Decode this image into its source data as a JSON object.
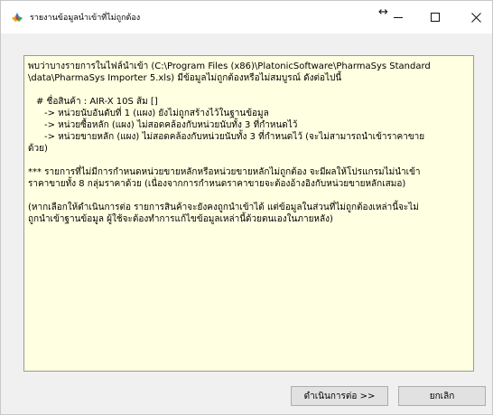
{
  "window": {
    "title": "รายงานข้อมูลนำเข้าที่ไม่ถูกต้อง",
    "app_icon": "pharmacy-app-icon",
    "controls": {
      "resize": "↔",
      "minimize": "minimize-icon",
      "maximize": "maximize-icon",
      "close": "×"
    }
  },
  "message": {
    "line1": "พบว่าบางรายการในไฟล์นำเข้า (C:\\Program Files (x86)\\PlatonicSoftware\\PharmaSys Standard",
    "line2": "\\data\\PharmaSys Importer 5.xls) มีข้อมูลไม่ถูกต้องหรือไม่สมบูรณ์ ดังต่อไปนี้",
    "product": "# ชื่อสินค้า : AIR-X 10S ส้ม []",
    "issue1": "-> หน่วยนับอันดับที่ 1 (แผง) ยังไม่ถูกสร้างไว้ในฐานข้อมูล",
    "issue2": "-> หน่วยซื้อหลัก (แผง) ไม่สอดคล้องกับหน่วยนับทั้ง 3 ที่กำหนดไว้",
    "issue3a": "-> หน่วยขายหลัก (แผง) ไม่สอดคล้องกับหน่วยนับทั้ง 3 ที่กำหนดไว้ (จะไม่สามารถนำเข้าราคาขาย",
    "issue3b": "ด้วย)",
    "note1a": "*** รายการที่ไม่มีการกำหนดหน่วยขายหลักหรือหน่วยขายหลักไม่ถูกต้อง จะมีผลให้โปรแกรมไม่นำเข้า",
    "note1b": "ราคาขายทั้ง 8 กลุ่มราคาด้วย (เนื่องจากการกำหนดราคาขายจะต้องอ้างอิงกับหน่วยขายหลักเสมอ)",
    "note2a": "(หากเลือกให้ดำเนินการต่อ รายการสินค้าจะยังคงถูกนำเข้าได้ แต่ข้อมูลในส่วนที่ไม่ถูกต้องเหล่านี้จะไม่",
    "note2b": "ถูกนำเข้าฐานข้อมูล ผู้ใช้จะต้องทำการแก้ไขข้อมูลเหล่านี้ด้วยตนเองในภายหลัง)"
  },
  "buttons": {
    "continue_label": "ดำเนินการต่อ >>",
    "cancel_label": "ยกเลิก"
  }
}
